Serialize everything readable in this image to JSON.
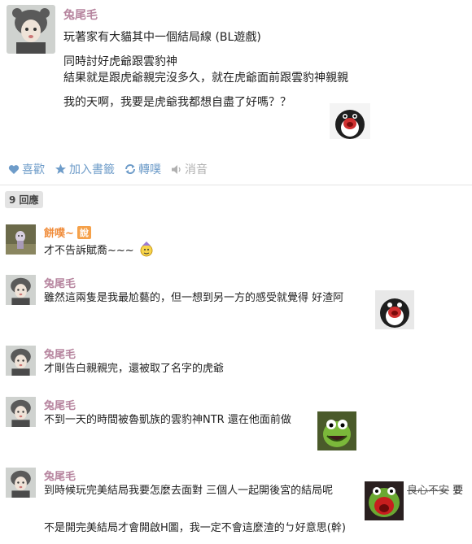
{
  "post": {
    "author": "兔尾毛",
    "lines": [
      "玩著家有大貓其中一個結局線 (BL遊戲)",
      "同時討好虎爺跟雲豹神",
      "結果就是跟虎爺親完沒多久，就在虎爺面前跟雲豹神親親",
      "我的天啊，我要是虎爺我都想自盡了好嗎？？"
    ],
    "sticker_icon": "pingu-shout-sticker"
  },
  "actions": {
    "like": "喜歡",
    "bookmark": "加入書籤",
    "repost": "轉噗",
    "mute": "消音"
  },
  "reply_count": "9 回應",
  "replies": [
    {
      "author": "餅噗~",
      "badge": "說",
      "text": "才不告訴賦喬~~~"
    },
    {
      "author": "兔尾毛",
      "text": "雖然這兩隻是我最尬藝的，但一想到另一方的感受就覺得 好渣阿"
    },
    {
      "author": "兔尾毛",
      "text": "才剛告白親親完，還被取了名字的虎爺"
    },
    {
      "author": "兔尾毛",
      "text": "不到一天的時間被魯凱族的雲豹神NTR 還在他面前做"
    },
    {
      "author": "兔尾毛",
      "text_a": "到時候玩完美結局我要怎麼去面對 三個人一起開後宮的結局呢",
      "text_strike": "良心不安",
      "text_b": "要",
      "text_line2": "不是開完美結局才會開啟H圖，我一定不會這麼渣的ㄅ好意思(幹)"
    }
  ],
  "colors": {
    "author_purple": "#b6849e",
    "author_orange": "#f08c3a",
    "action_blue": "#6e9cc9"
  }
}
